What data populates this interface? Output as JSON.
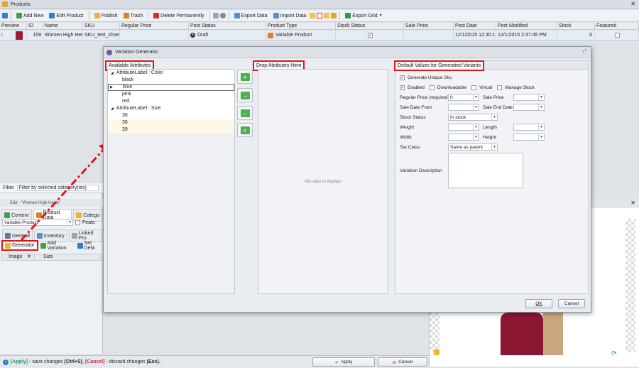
{
  "window": {
    "title": "Products"
  },
  "toolbar": {
    "add_new": "Add New",
    "edit_product": "Edit Product",
    "publish": "Publish",
    "trash": "Trash",
    "delete_permanently": "Delete Permanently",
    "export_data": "Export Data",
    "import_data": "Import Data",
    "export_grid": "Export Grid"
  },
  "grid": {
    "columns": [
      "Preview",
      "ID",
      "Name",
      "SKU",
      "Regular Price",
      "Post Status",
      "Product Type",
      "Stock Status",
      "Sale Price",
      "Post Date",
      "Post Modified",
      "Stock",
      "Featured"
    ],
    "row": {
      "id": "159",
      "name": "Women High Heels",
      "sku": "SKU_test_shoes",
      "regular_price": "",
      "post_status": "Draft",
      "product_type": "Variable Product",
      "sale_price": "",
      "post_date": "12/1/2015 12:30:16",
      "post_modified": "12/1/2015 2:37:45 PM",
      "stock": "0"
    }
  },
  "left": {
    "filter_label": "Filter",
    "filter_value": "Filter by selected category(ies)",
    "edit_title": "Edit - \"Women High Heels\"",
    "tabs": [
      "Content",
      "Product Data",
      "Catego"
    ],
    "product_type": "Variable Product",
    "featured_label": "Featu",
    "subtabs": [
      "General",
      "Inventory",
      "Linked Pro"
    ],
    "generator": "Generator",
    "add_variation": "Add Variation",
    "set_default": "Set Defa",
    "cols": [
      "Image",
      "#",
      "Size"
    ]
  },
  "dialog": {
    "title": "Variation Generator",
    "available_attributes": "Available Attributes",
    "drop_attributes": "Drop Attributes Here",
    "defaults_title": "Default Values for Generated Variants",
    "no_data": "<No data to display>",
    "tree": [
      {
        "group": "AttributeLabel : Color",
        "items": [
          "black",
          "blue",
          "pink",
          "red"
        ]
      },
      {
        "group": "AttributeLabel : Size",
        "items": [
          "36",
          "38",
          "39"
        ]
      }
    ],
    "form": {
      "generate_unique_sku": "Generate Unique Sku",
      "enabled": "Enabled",
      "downloadable": "Downloadable",
      "virtual": "Virtual",
      "manage_stock": "Manage Stock",
      "regular_price_label": "Regular Price (required)",
      "regular_price_value": "0",
      "sale_price_label": "Sale Price",
      "sale_date_from": "Sale Date From",
      "sale_end_date": "Sale End Date",
      "stock_status_label": "Stock Status",
      "stock_status_value": "In stock",
      "weight": "Weight",
      "length": "Length",
      "width": "Width",
      "height": "Height",
      "tax_class_label": "Tax Class",
      "tax_class_value": "Same as parent",
      "variation_description": "Variation Description"
    },
    "ok": "OK",
    "cancel": "Cancel"
  },
  "status": {
    "apply_hint_key": "[Apply]",
    "apply_hint_text": " - save changes ",
    "apply_shortcut": "(Ctrl+S)",
    "cancel_hint_key": "[Cancel]",
    "cancel_hint_text": " - discard changes ",
    "cancel_shortcut": "(Esc).",
    "apply_button": "Apply",
    "cancel_button": "Cancel"
  },
  "colors": {
    "accent_red": "#e0161b",
    "selection": "#cfe0f5",
    "green": "#4caf50"
  }
}
